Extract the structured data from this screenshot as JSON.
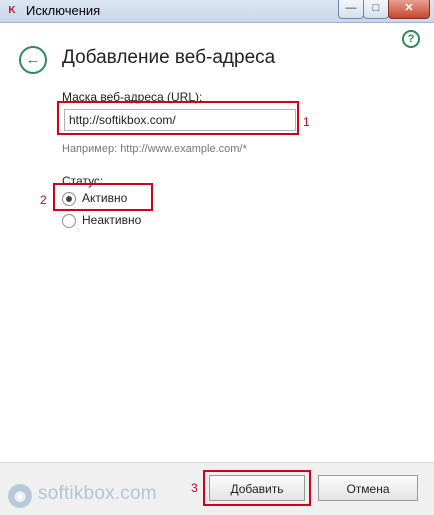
{
  "window": {
    "title": "Исключения",
    "app_icon_glyph": "K",
    "controls": {
      "minimize": "—",
      "maximize": "□",
      "close": "✕"
    }
  },
  "help_glyph": "?",
  "back_glyph": "←",
  "page": {
    "title": "Добавление веб-адреса"
  },
  "url_field": {
    "label": "Маска веб-адреса (URL):",
    "value": "http://softikbox.com/",
    "hint": "Например: http://www.example.com/*"
  },
  "status": {
    "label": "Статус:",
    "options": [
      {
        "label": "Активно",
        "checked": true
      },
      {
        "label": "Неактивно",
        "checked": false
      }
    ]
  },
  "annotations": {
    "n1": "1",
    "n2": "2",
    "n3": "3"
  },
  "buttons": {
    "add": "Добавить",
    "cancel": "Отмена"
  },
  "watermark": {
    "text": "softikbox.com"
  },
  "colors": {
    "accent": "#2e8b57",
    "annotation": "#d0021b"
  }
}
